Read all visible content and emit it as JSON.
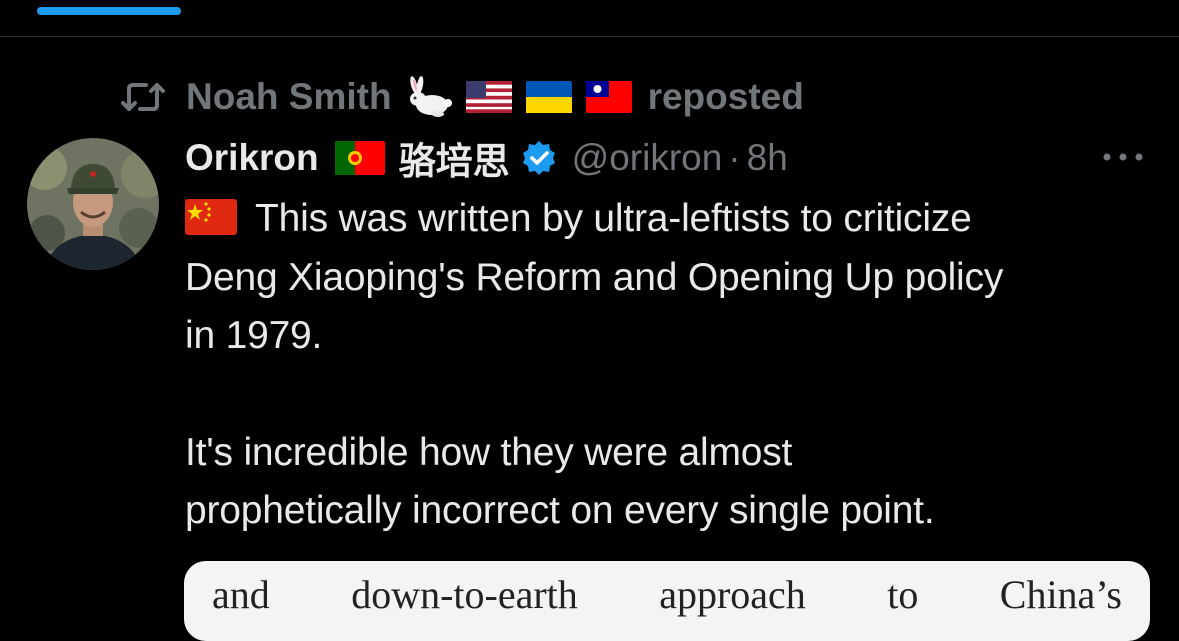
{
  "repost": {
    "icon": "repost-icon",
    "name": "Noah Smith",
    "badges": [
      "rabbit-icon",
      "us-flag-icon",
      "ukraine-flag-icon",
      "taiwan-flag-icon"
    ],
    "suffix": "reposted",
    "color": "#71767b"
  },
  "tweet": {
    "author": {
      "display_name": "Orikron",
      "flag": "portugal-flag-icon",
      "chinese_name": "骆培思",
      "verified": true,
      "handle": "@orikron",
      "separator": "·",
      "time": "8h"
    },
    "more_icon": "more-options-icon",
    "text_flag": "china-flag-icon",
    "paragraph1_lines": [
      "This was written by ultra-leftists to criticize",
      "Deng Xiaoping's Reform and Opening Up policy",
      "in 1979."
    ],
    "paragraph2_lines": [
      "It's incredible how they were almost",
      "prophetically incorrect on every single point."
    ],
    "media_words": [
      "and",
      "down-to-earth",
      "approach",
      "to",
      "China’s"
    ]
  },
  "colors": {
    "background": "#000000",
    "text": "#e7e9ea",
    "muted": "#71767b",
    "accent": "#1d9bf0",
    "divider": "#2f3336"
  }
}
